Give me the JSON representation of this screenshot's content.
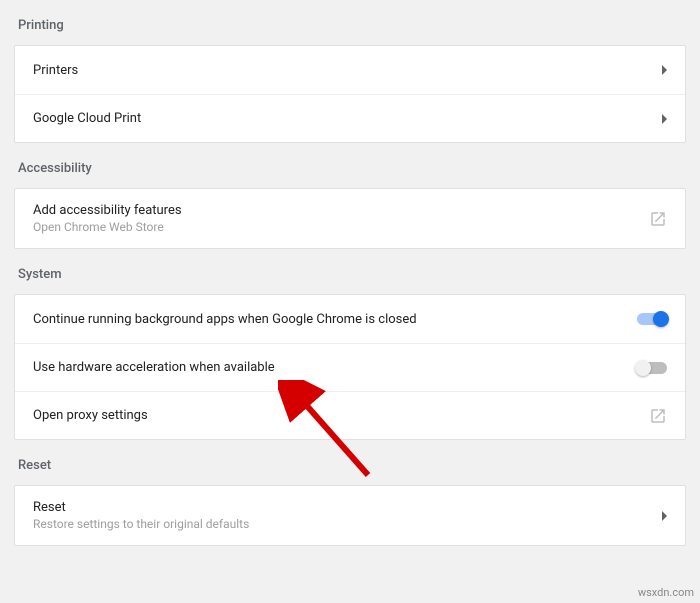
{
  "sections": {
    "printing": {
      "header": "Printing",
      "items": {
        "printers": "Printers",
        "cloud": "Google Cloud Print"
      }
    },
    "accessibility": {
      "header": "Accessibility",
      "items": {
        "add": {
          "title": "Add accessibility features",
          "sub": "Open Chrome Web Store"
        }
      }
    },
    "system": {
      "header": "System",
      "items": {
        "background": "Continue running background apps when Google Chrome is closed",
        "hardware": "Use hardware acceleration when available",
        "proxy": "Open proxy settings"
      },
      "toggles": {
        "background": true,
        "hardware": false
      }
    },
    "reset": {
      "header": "Reset",
      "items": {
        "reset": {
          "title": "Reset",
          "sub": "Restore settings to their original defaults"
        }
      }
    }
  },
  "watermark": "wsxdn.com"
}
